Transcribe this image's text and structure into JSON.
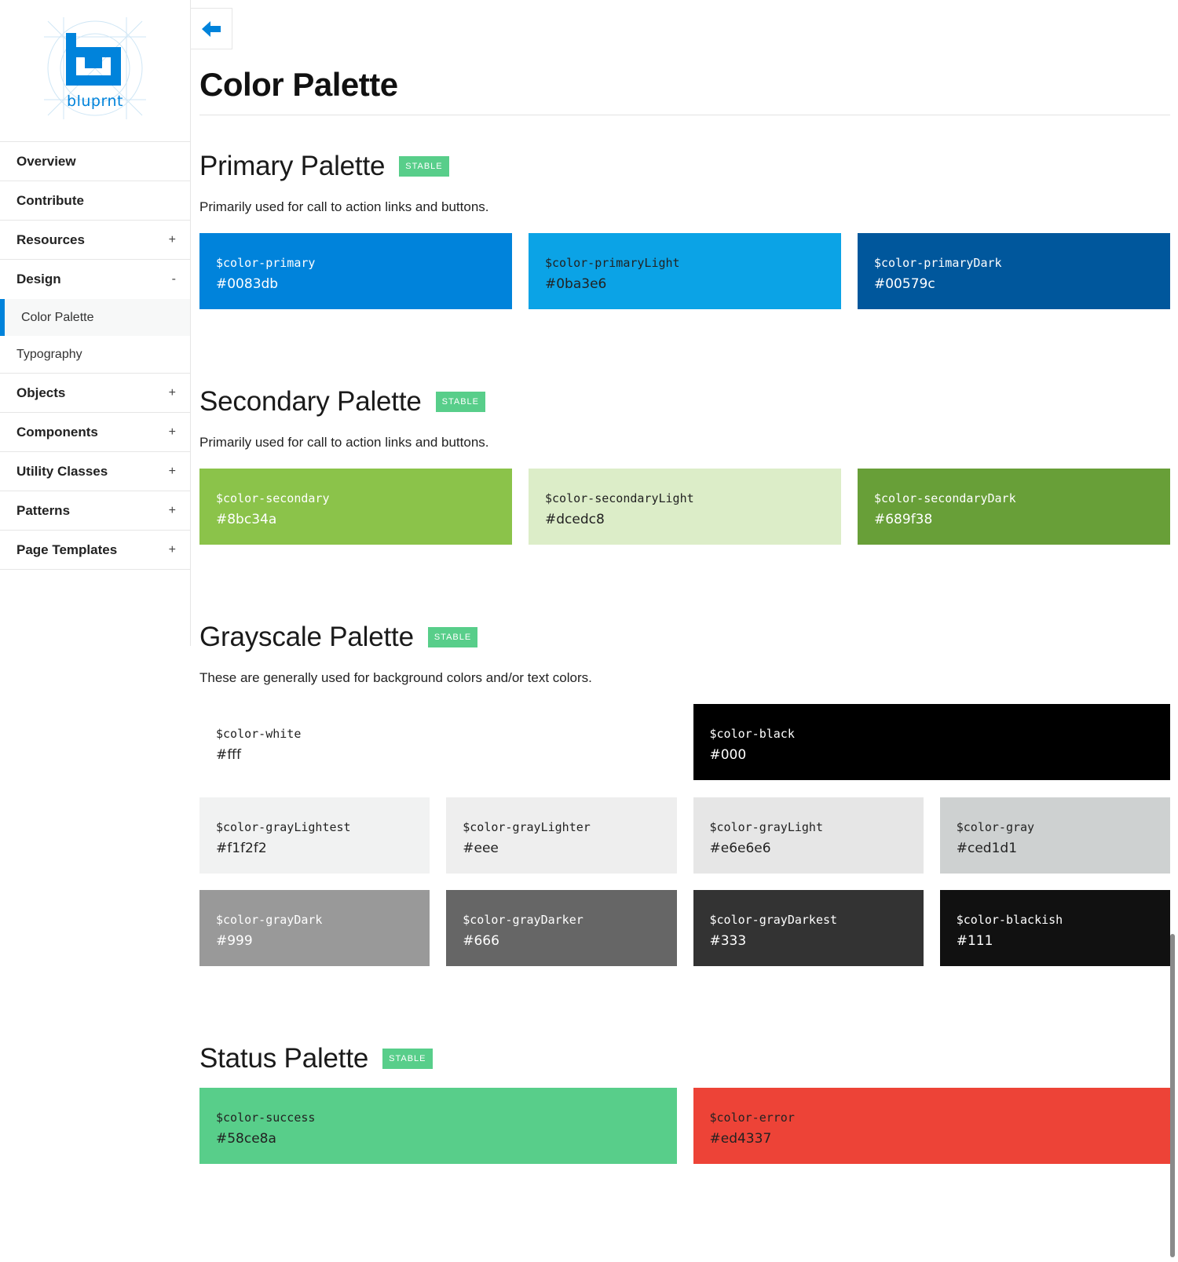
{
  "brand": {
    "logo_text": "bluprnt",
    "accent": "#0083db"
  },
  "sidebar": {
    "items": [
      {
        "label": "Overview",
        "toggle": ""
      },
      {
        "label": "Contribute",
        "toggle": ""
      },
      {
        "label": "Resources",
        "toggle": "+"
      },
      {
        "label": "Design",
        "toggle": "-",
        "children": [
          {
            "label": "Color Palette",
            "active": true
          },
          {
            "label": "Typography",
            "active": false
          }
        ]
      },
      {
        "label": "Objects",
        "toggle": "+"
      },
      {
        "label": "Components",
        "toggle": "+"
      },
      {
        "label": "Utility Classes",
        "toggle": "+"
      },
      {
        "label": "Patterns",
        "toggle": "+"
      },
      {
        "label": "Page Templates",
        "toggle": "+"
      }
    ]
  },
  "back_button": {
    "icon": "arrow-left-icon"
  },
  "page": {
    "title": "Color Palette"
  },
  "sections": [
    {
      "title": "Primary Palette",
      "badge": "STABLE",
      "description": "Primarily used for call to action links and buttons.",
      "rows": [
        [
          {
            "var": "$color-primary",
            "hex": "#0083db",
            "bg": "#0083db",
            "text": "light"
          },
          {
            "var": "$color-primaryLight",
            "hex": "#0ba3e6",
            "bg": "#0ba3e6",
            "text": "dark"
          },
          {
            "var": "$color-primaryDark",
            "hex": "#00579c",
            "bg": "#00579c",
            "text": "light"
          }
        ]
      ]
    },
    {
      "title": "Secondary Palette",
      "badge": "STABLE",
      "description": "Primarily used for call to action links and buttons.",
      "rows": [
        [
          {
            "var": "$color-secondary",
            "hex": "#8bc34a",
            "bg": "#8bc34a",
            "text": "light"
          },
          {
            "var": "$color-secondaryLight",
            "hex": "#dcedc8",
            "bg": "#dcedc8",
            "text": "dark"
          },
          {
            "var": "$color-secondaryDark",
            "hex": "#689f38",
            "bg": "#689f38",
            "text": "light"
          }
        ]
      ]
    },
    {
      "title": "Grayscale Palette",
      "badge": "STABLE",
      "description": "These are generally used for background colors and/or text colors.",
      "rows": [
        [
          {
            "var": "$color-white",
            "hex": "#fff",
            "bg": "#ffffff",
            "text": "dark"
          },
          {
            "var": "$color-black",
            "hex": "#000",
            "bg": "#000000",
            "text": "light"
          }
        ],
        [
          {
            "var": "$color-grayLightest",
            "hex": "#f1f2f2",
            "bg": "#f1f2f2",
            "text": "dark"
          },
          {
            "var": "$color-grayLighter",
            "hex": "#eee",
            "bg": "#eeeeee",
            "text": "dark"
          },
          {
            "var": "$color-grayLight",
            "hex": "#e6e6e6",
            "bg": "#e6e6e6",
            "text": "dark"
          },
          {
            "var": "$color-gray",
            "hex": "#ced1d1",
            "bg": "#ced1d1",
            "text": "dark"
          }
        ],
        [
          {
            "var": "$color-grayDark",
            "hex": "#999",
            "bg": "#999999",
            "text": "light"
          },
          {
            "var": "$color-grayDarker",
            "hex": "#666",
            "bg": "#666666",
            "text": "light"
          },
          {
            "var": "$color-grayDarkest",
            "hex": "#333",
            "bg": "#333333",
            "text": "light"
          },
          {
            "var": "$color-blackish",
            "hex": "#111",
            "bg": "#111111",
            "text": "light"
          }
        ]
      ]
    },
    {
      "title": "Status Palette",
      "badge": "STABLE",
      "description": "",
      "rows": [
        [
          {
            "var": "$color-success",
            "hex": "#58ce8a",
            "bg": "#58ce8a",
            "text": "dark"
          },
          {
            "var": "$color-error",
            "hex": "#ed4337",
            "bg": "#ed4337",
            "text": "dark"
          }
        ]
      ]
    }
  ]
}
